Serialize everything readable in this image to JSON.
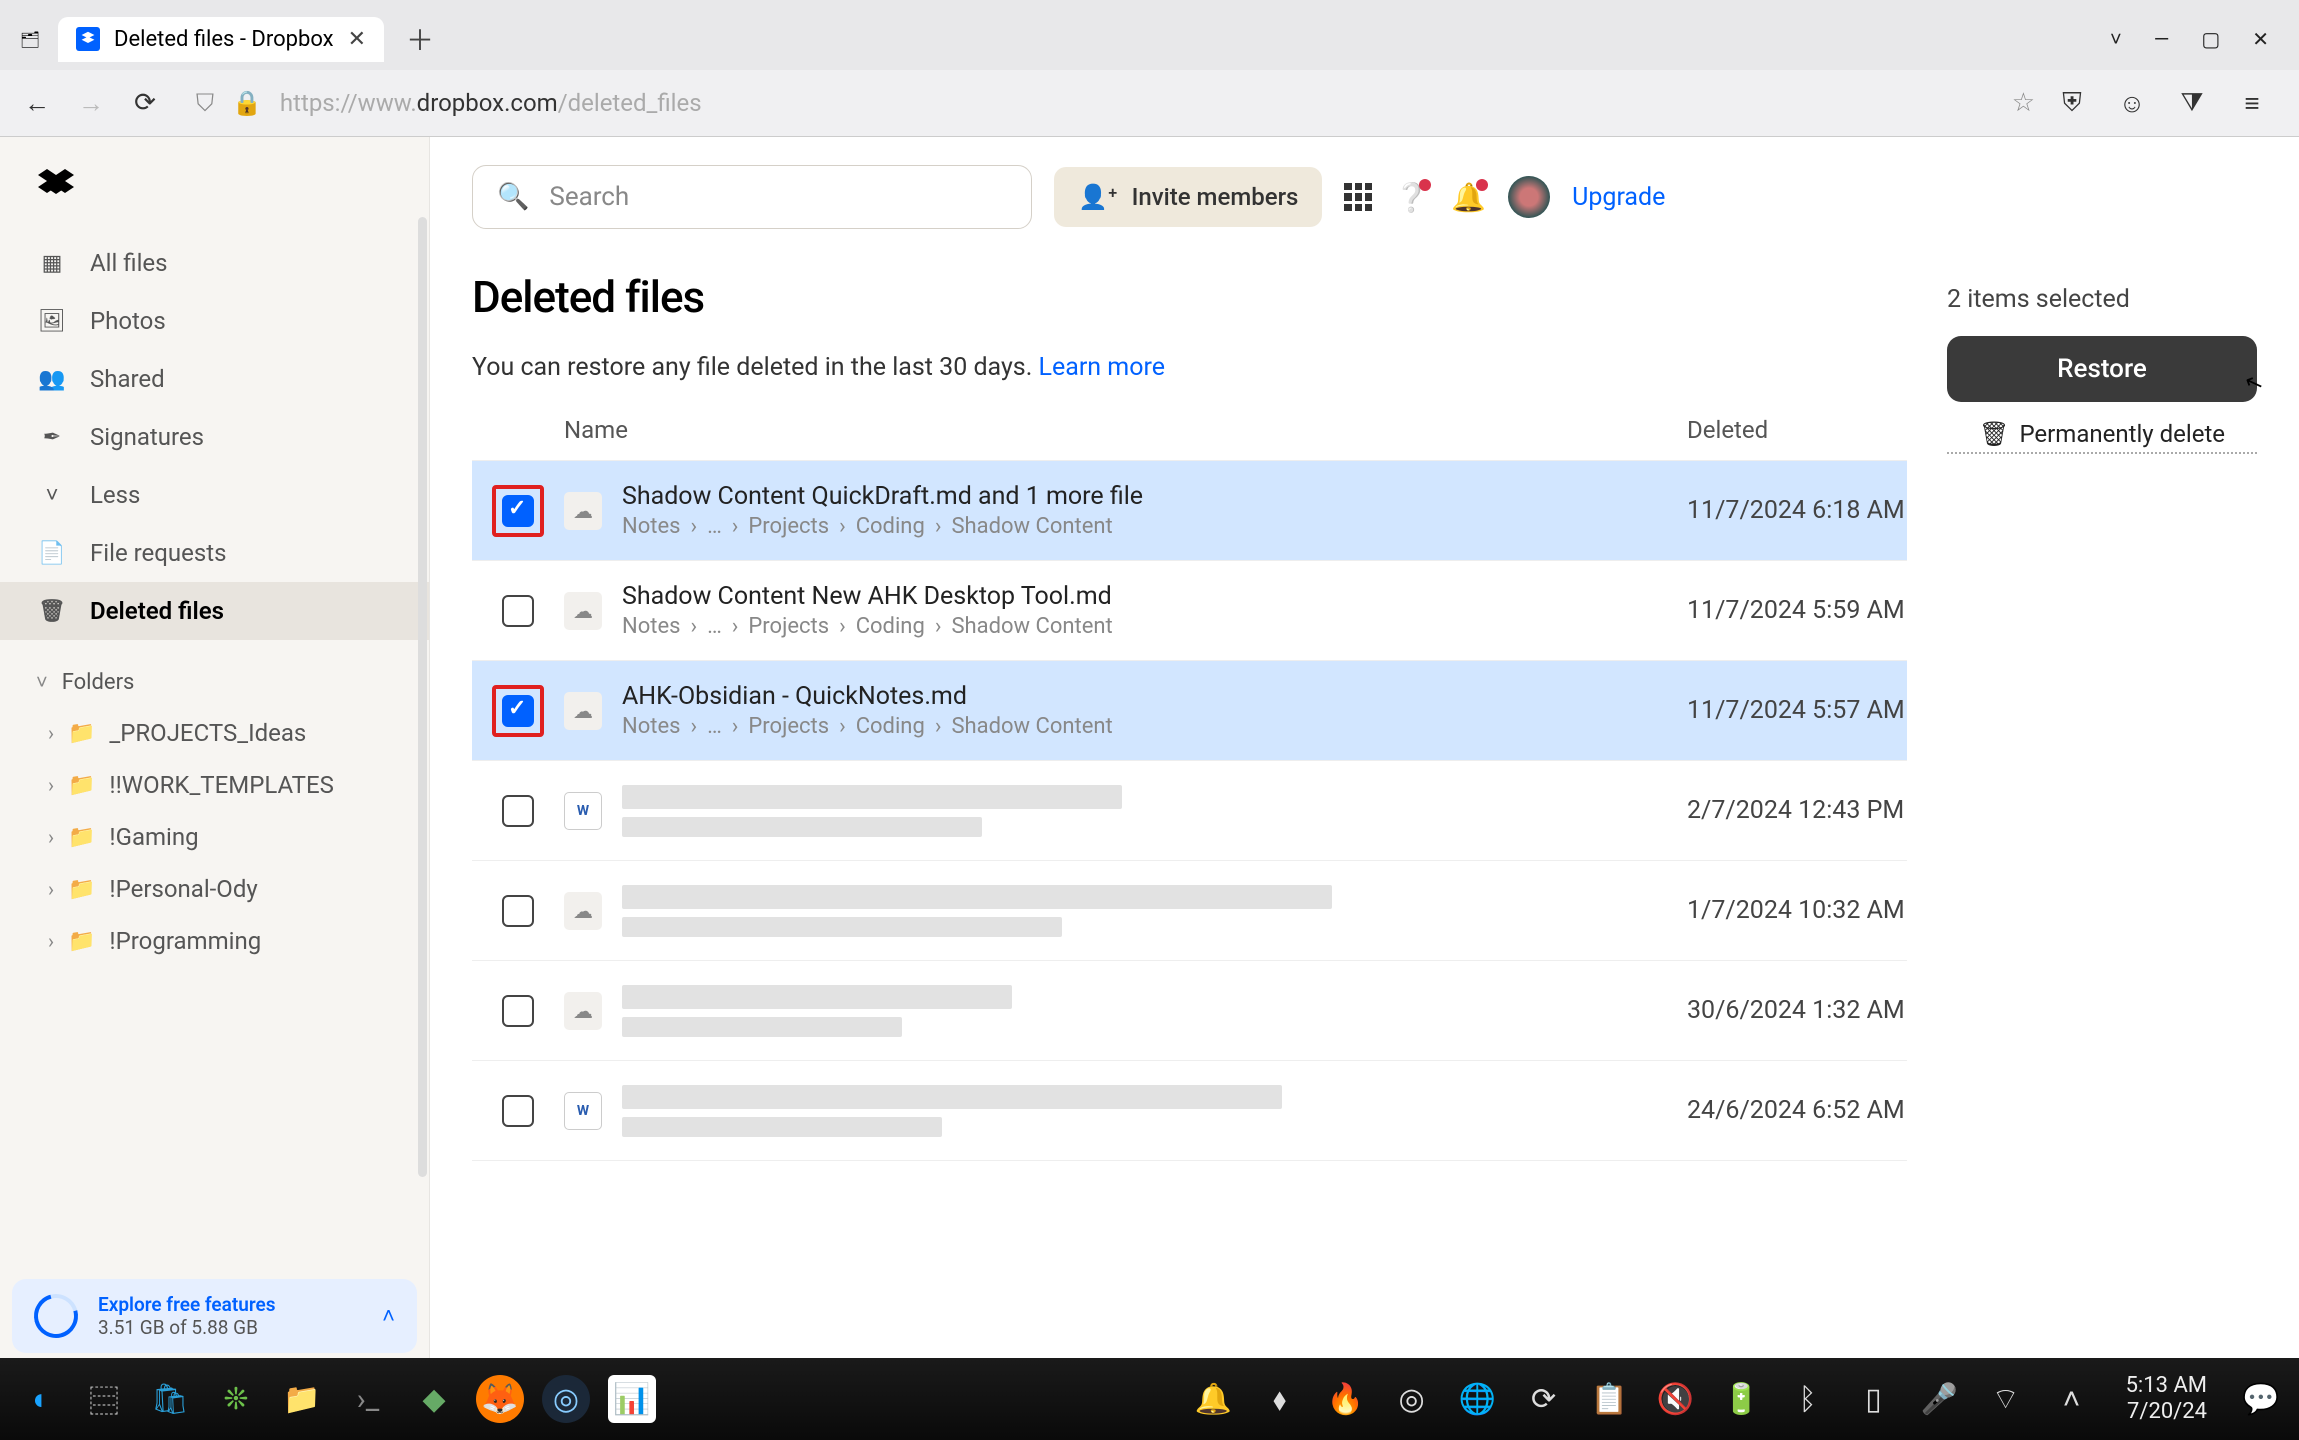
{
  "browser": {
    "tab_title": "Deleted files - Dropbox",
    "url_prefix": "https://www.",
    "url_host": "dropbox.com",
    "url_path": "/deleted_files"
  },
  "sidebar": {
    "nav": [
      {
        "icon": "▦",
        "label": "All files"
      },
      {
        "icon": "🖼",
        "label": "Photos"
      },
      {
        "icon": "👥",
        "label": "Shared"
      },
      {
        "icon": "✒",
        "label": "Signatures"
      },
      {
        "icon": "˅",
        "label": "Less"
      },
      {
        "icon": "📄",
        "label": "File requests"
      },
      {
        "icon": "🗑",
        "label": "Deleted files"
      }
    ],
    "folders_label": "Folders",
    "folders": [
      "_PROJECTS_Ideas",
      "!!WORK_TEMPLATES",
      "!Gaming",
      "!Personal-Ody",
      "!Programming"
    ],
    "promo": {
      "title": "Explore free features",
      "sub": "3.51 GB of 5.88 GB"
    }
  },
  "top": {
    "search_placeholder": "Search",
    "invite": "Invite members",
    "upgrade": "Upgrade"
  },
  "page": {
    "title": "Deleted files",
    "sub": "You can restore any file deleted in the last 30 days. ",
    "learn_more": "Learn more",
    "columns": {
      "name": "Name",
      "deleted": "Deleted"
    }
  },
  "rows": [
    {
      "selected": true,
      "highlighted": true,
      "icon": "obs",
      "name": "Shadow Content QuickDraft.md and 1 more file",
      "path": [
        "Notes",
        "…",
        "Projects",
        "Coding",
        "Shadow Content"
      ],
      "date": "11/7/2024 6:18 AM",
      "redacted": false
    },
    {
      "selected": false,
      "highlighted": false,
      "icon": "obs",
      "name": "Shadow Content New AHK Desktop Tool.md",
      "path": [
        "Notes",
        "…",
        "Projects",
        "Coding",
        "Shadow Content"
      ],
      "date": "11/7/2024 5:59 AM",
      "redacted": false
    },
    {
      "selected": true,
      "highlighted": true,
      "icon": "obs",
      "name": "AHK-Obsidian - QuickNotes.md",
      "path": [
        "Notes",
        "…",
        "Projects",
        "Coding",
        "Shadow Content"
      ],
      "date": "11/7/2024 5:57 AM",
      "redacted": false
    },
    {
      "selected": false,
      "highlighted": false,
      "icon": "doc",
      "name": "",
      "path": [],
      "date": "2/7/2024 12:43 PM",
      "redacted": true,
      "rw1": 500,
      "rw2": 360
    },
    {
      "selected": false,
      "highlighted": false,
      "icon": "obs",
      "name": "",
      "path": [],
      "date": "1/7/2024 10:32 AM",
      "redacted": true,
      "rw1": 710,
      "rw2": 440
    },
    {
      "selected": false,
      "highlighted": false,
      "icon": "obs",
      "name": "",
      "path": [],
      "date": "30/6/2024 1:32 AM",
      "redacted": true,
      "rw1": 390,
      "rw2": 280
    },
    {
      "selected": false,
      "highlighted": false,
      "icon": "doc",
      "name": "",
      "path": [],
      "date": "24/6/2024 6:52 AM",
      "redacted": true,
      "rw1": 660,
      "rw2": 320
    }
  ],
  "side": {
    "selected_text": "2 items selected",
    "restore": "Restore",
    "perm_delete": "Permanently delete"
  },
  "taskbar": {
    "time": "5:13 AM",
    "date": "7/20/24"
  }
}
